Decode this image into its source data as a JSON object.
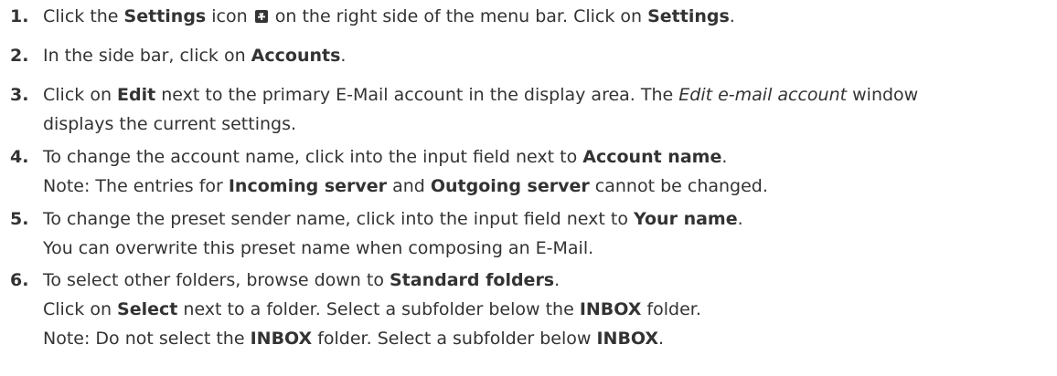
{
  "steps": [
    {
      "number": "1.",
      "lines": [
        [
          {
            "t": "Click the "
          },
          {
            "t": "Settings",
            "b": true
          },
          {
            "t": " icon "
          },
          {
            "icon": "settings-icon"
          },
          {
            "t": " on the right side of the menu bar. Click on "
          },
          {
            "t": "Settings",
            "b": true
          },
          {
            "t": "."
          }
        ]
      ]
    },
    {
      "number": "2.",
      "lines": [
        [
          {
            "t": "In the side bar, click on "
          },
          {
            "t": "Accounts",
            "b": true
          },
          {
            "t": "."
          }
        ]
      ]
    },
    {
      "number": "3.",
      "lines": [
        [
          {
            "t": "Click on "
          },
          {
            "t": "Edit",
            "b": true
          },
          {
            "t": " next to the primary E-Mail account in the display area. The "
          },
          {
            "t": "Edit e-mail account",
            "i": true
          },
          {
            "t": " window"
          }
        ],
        [
          {
            "t": "displays the current settings."
          }
        ]
      ]
    },
    {
      "number": "4.",
      "lines": [
        [
          {
            "t": "To change the account name, click into the input field next to "
          },
          {
            "t": "Account name",
            "b": true
          },
          {
            "t": "."
          }
        ],
        [
          {
            "t": "Note: The entries for "
          },
          {
            "t": "Incoming server",
            "b": true
          },
          {
            "t": " and "
          },
          {
            "t": "Outgoing server",
            "b": true
          },
          {
            "t": " cannot be changed."
          }
        ]
      ]
    },
    {
      "number": "5.",
      "lines": [
        [
          {
            "t": "To change the preset sender name, click into the input field next to "
          },
          {
            "t": "Your name",
            "b": true
          },
          {
            "t": "."
          }
        ],
        [
          {
            "t": "You can overwrite this preset name when composing an E-Mail."
          }
        ]
      ]
    },
    {
      "number": "6.",
      "lines": [
        [
          {
            "t": "To select other folders, browse down to "
          },
          {
            "t": "Standard folders",
            "b": true
          },
          {
            "t": "."
          }
        ],
        [
          {
            "t": "Click on "
          },
          {
            "t": "Select",
            "b": true
          },
          {
            "t": " next to a folder. Select a subfolder below the "
          },
          {
            "t": "INBOX",
            "b": true
          },
          {
            "t": " folder."
          }
        ],
        [
          {
            "t": "Note: Do not select the "
          },
          {
            "t": "INBOX",
            "b": true
          },
          {
            "t": " folder. Select a subfolder below "
          },
          {
            "t": "INBOX",
            "b": true
          },
          {
            "t": "."
          }
        ]
      ]
    }
  ]
}
